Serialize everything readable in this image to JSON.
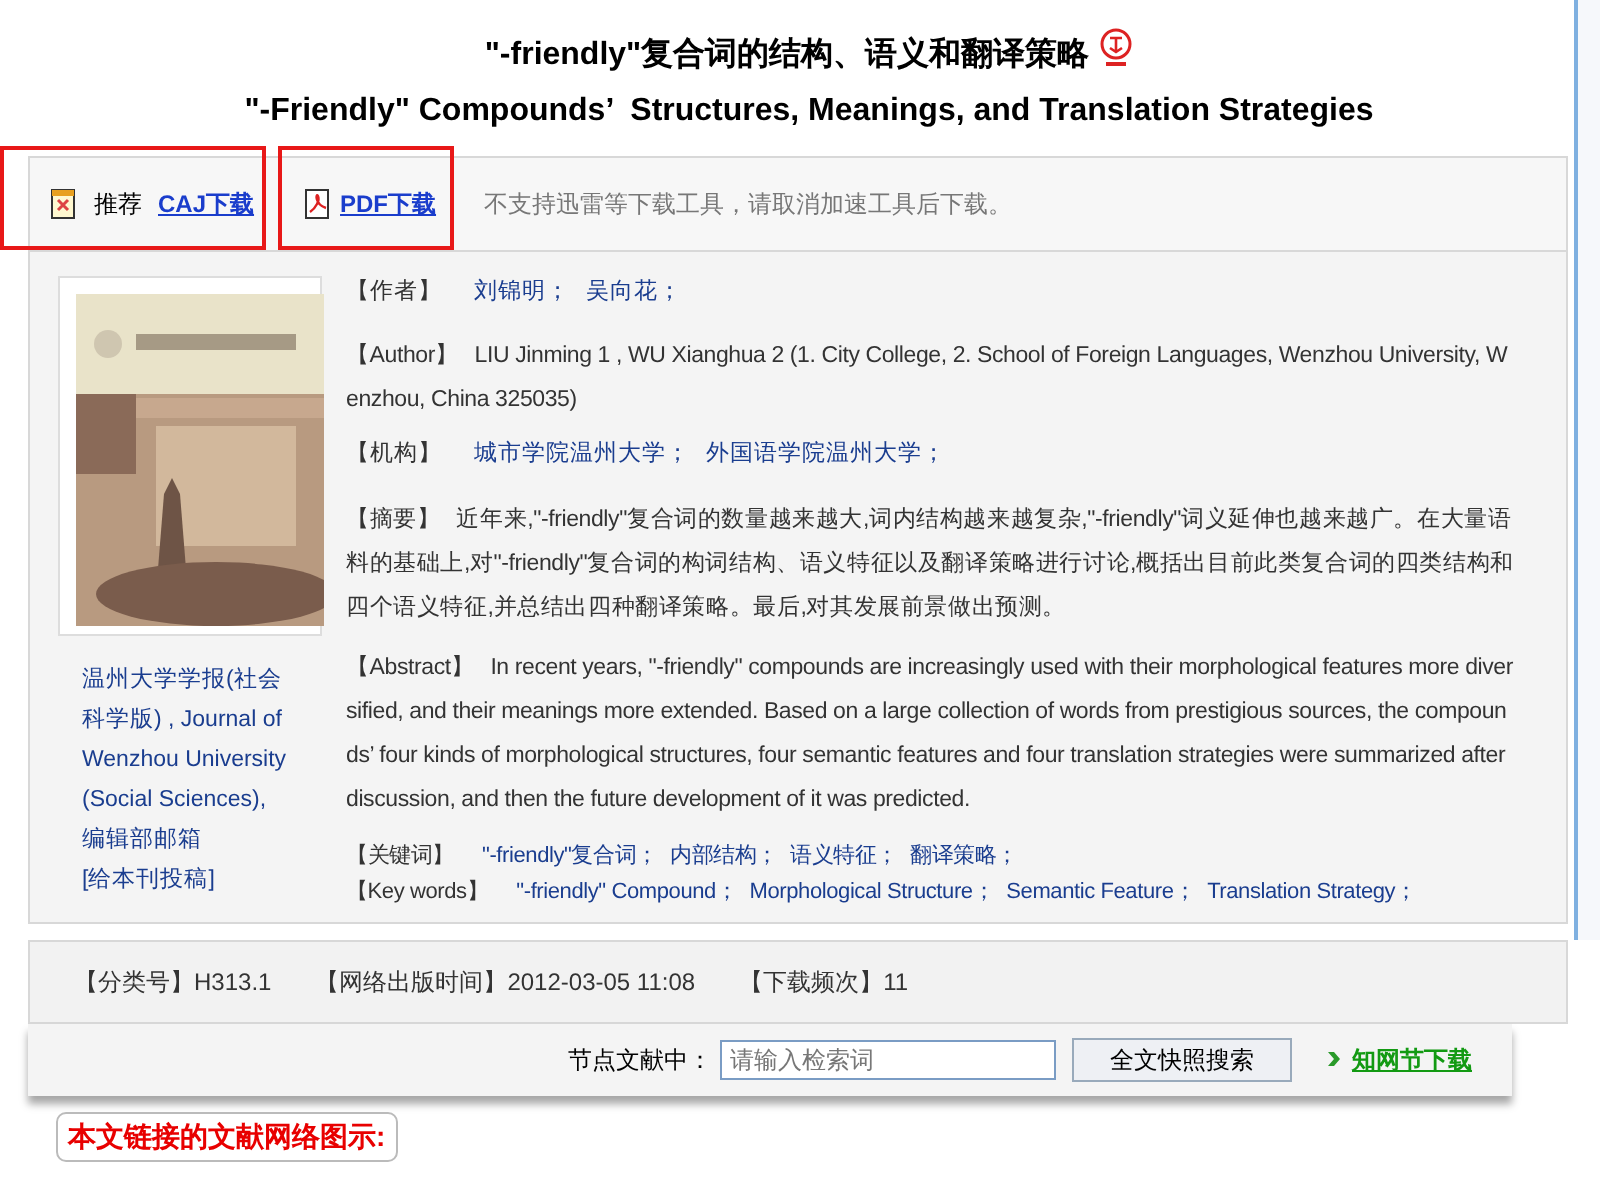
{
  "title": {
    "zh": "\"-friendly\"复合词的结构、语义和翻译策略",
    "en": "\"-Friendly\" Compounds’  Structures, Meanings, and Translation Strategies"
  },
  "downloads": {
    "recommend": "推荐",
    "caj": "CAJ下载",
    "pdf": "PDF下载",
    "notice": "不支持迅雷等下载工具，请取消加速工具后下载。"
  },
  "journal": {
    "name": "温州大学学报(社会科学版) , Journal of Wenzhou University (Social Sciences),",
    "mailbox": "编辑部邮箱",
    "submit": "[给本刊投稿]"
  },
  "fields": [
    {
      "kind": "links",
      "label": "【作者】",
      "items": [
        "刘锦明；",
        "吴向花；"
      ]
    },
    {
      "kind": "text",
      "label": "【Author】",
      "text": "LIU Jinming 1 , WU Xianghua 2 (1. City College, 2. School of Foreign Languages, Wenzhou University, Wenzhou, China 325035)"
    },
    {
      "kind": "links",
      "label": "【机构】",
      "items": [
        "城市学院温州大学；",
        "外国语学院温州大学；"
      ]
    },
    {
      "kind": "text",
      "label": "【摘要】",
      "text": "近年来,\"-friendly\"复合词的数量越来越大,词内结构越来越复杂,\"-friendly\"词义延伸也越来越广。在大量语料的基础上,对\"-friendly\"复合词的构词结构、语义特征以及翻译策略进行讨论,概括出目前此类复合词的四类结构和四个语义特征,并总结出四种翻译策略。最后,对其发展前景做出预测。"
    },
    {
      "kind": "text",
      "label": "【Abstract】",
      "text": "In recent years, \"-friendly\" compounds are increasingly used with their morphological features more diversified, and their meanings more extended. Based on a large collection of words from prestigious sources, the compounds’  four kinds of morphological structures, four semantic features and four translation strategies were summarized after discussion, and then the future development of it was predicted."
    },
    {
      "kind": "keywords",
      "label": "【关键词】",
      "items": [
        "\"-friendly\"复合词；",
        "内部结构；",
        "语义特征；",
        "翻译策略；"
      ]
    },
    {
      "kind": "keywords",
      "label": "【Key words】",
      "items": [
        "\"-friendly\" Compound；",
        "Morphological Structure；",
        "Semantic Feature；",
        "Translation Strategy；"
      ]
    }
  ],
  "info": [
    {
      "label": "【分类号】",
      "value": "H313.1"
    },
    {
      "label": "【网络出版时间】",
      "value": "2012-03-05 11:08"
    },
    {
      "label": "【下载频次】",
      "value": "11"
    }
  ],
  "search": {
    "label": "节点文献中：",
    "placeholder": "请输入检索词",
    "button": "全文快照搜索",
    "link": "知网节下载"
  },
  "network_button": "本文链接的文献网络图示:"
}
